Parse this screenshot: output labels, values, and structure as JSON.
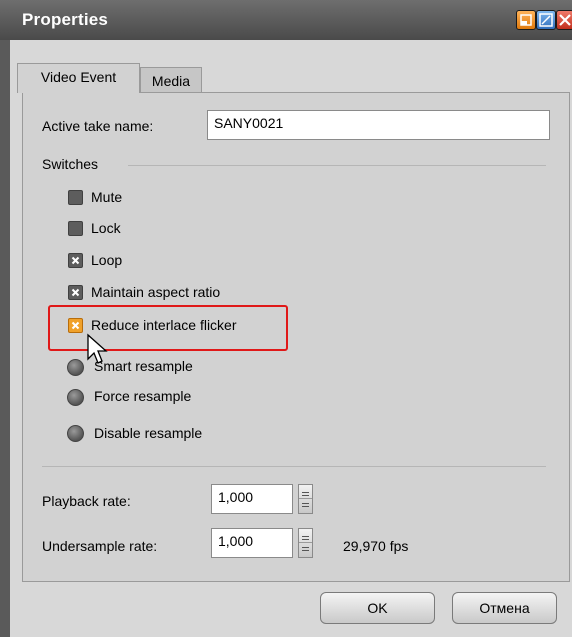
{
  "window": {
    "title": "Properties"
  },
  "tabs": [
    {
      "label": "Video Event",
      "active": true
    },
    {
      "label": "Media",
      "active": false
    }
  ],
  "active_take": {
    "label": "Active take name:",
    "value": "SANY0021"
  },
  "switches": {
    "heading": "Switches",
    "checkboxes": [
      {
        "label": "Mute",
        "checked": false
      },
      {
        "label": "Lock",
        "checked": false
      },
      {
        "label": "Loop",
        "checked": true
      },
      {
        "label": "Maintain aspect ratio",
        "checked": true
      },
      {
        "label": "Reduce interlace flicker",
        "checked": true
      }
    ],
    "radios": [
      {
        "label": "Smart resample",
        "selected": true
      },
      {
        "label": "Force resample",
        "selected": false
      },
      {
        "label": "Disable resample",
        "selected": false
      }
    ]
  },
  "playback_rate": {
    "label": "Playback rate:",
    "value": "1,000"
  },
  "undersample_rate": {
    "label": "Undersample rate:",
    "value": "1,000",
    "fps": "29,970 fps"
  },
  "buttons": {
    "ok": "OK",
    "cancel": "Отмена"
  },
  "colors": {
    "highlight": "#e01818",
    "accent_checkbox": "#f0a12a"
  }
}
